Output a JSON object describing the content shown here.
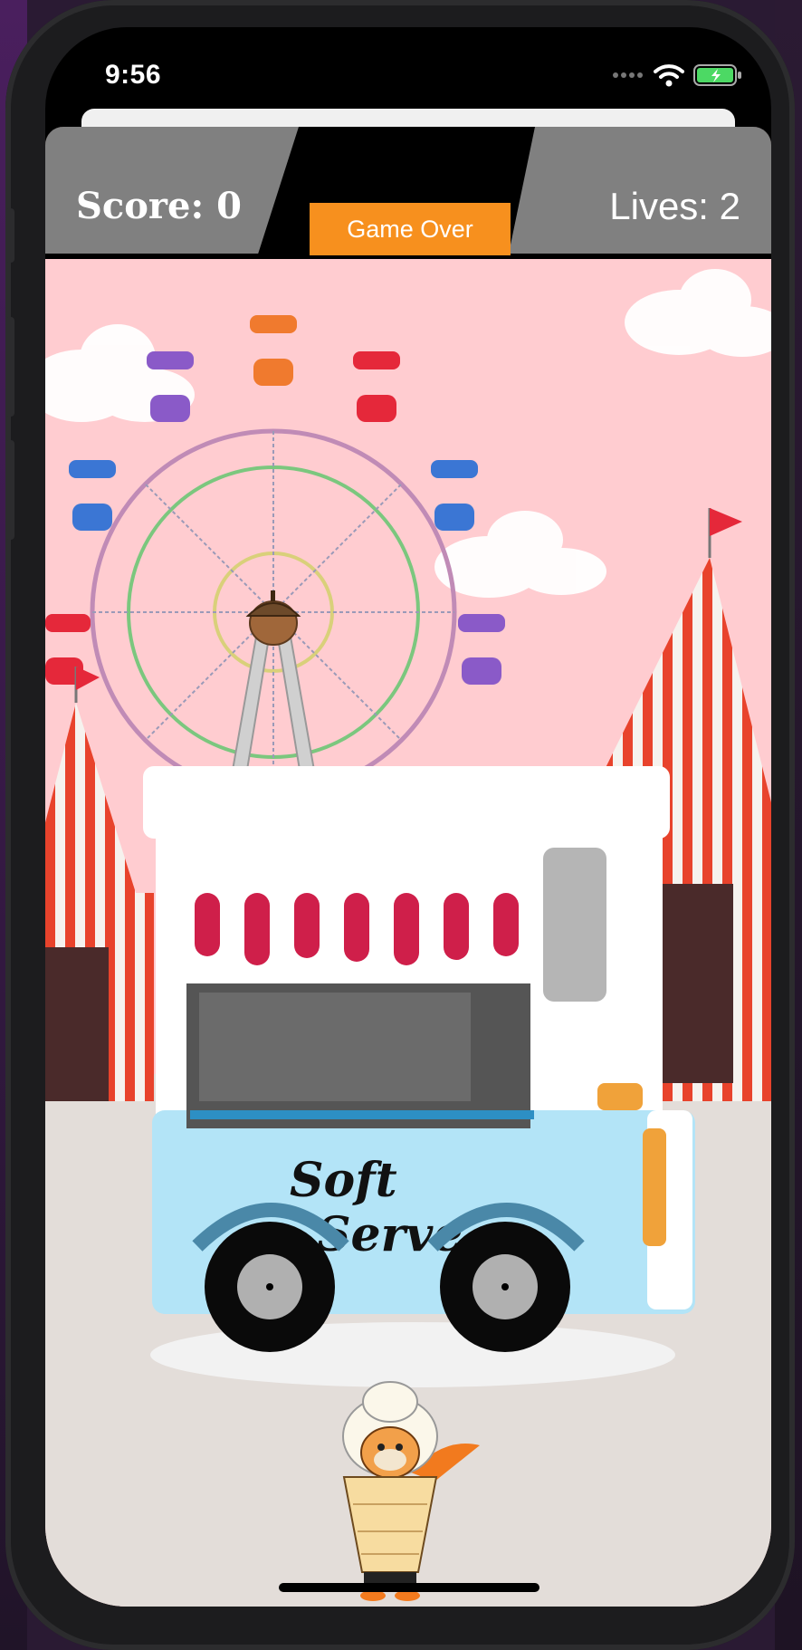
{
  "status_bar": {
    "time": "9:56",
    "icons": [
      "signal-dots-icon",
      "wifi-icon",
      "battery-charging-icon"
    ]
  },
  "hud": {
    "score_label": "Score: 0",
    "lives_label": "Lives: 2",
    "game_over_label": "Game Over"
  },
  "scene": {
    "truck_sign_line1": "Soft",
    "truck_sign_line2": "Serve",
    "objects": [
      "ferris-wheel",
      "circus-tent-left",
      "circus-tent-right",
      "ice-cream-truck",
      "acorn",
      "squirrel-in-cone",
      "clouds"
    ]
  },
  "colors": {
    "hud_gray": "#808080",
    "game_over_orange": "#f7901e",
    "sky_pink": "#ffccd0",
    "ground": "#e3ddd9",
    "truck_blue": "#b3e4f7",
    "tent_red": "#e8432c"
  }
}
